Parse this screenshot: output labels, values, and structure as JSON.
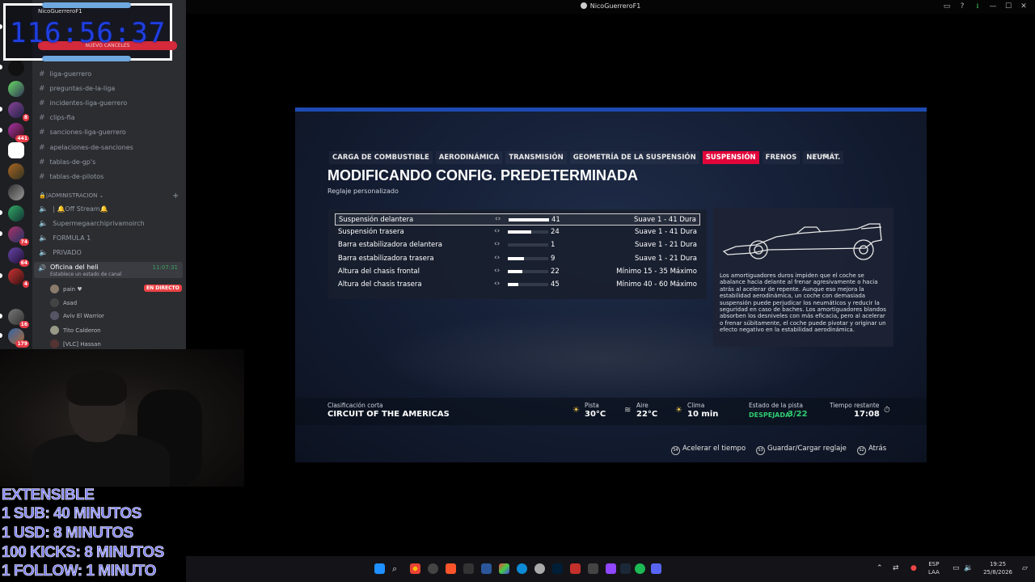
{
  "window": {
    "title": "NicoGuerreroF1"
  },
  "timer": {
    "value": "116:56:37",
    "overlay_name": "NicoGuerreroF1",
    "overlay_bar": "NUEVO CANCELES"
  },
  "discord": {
    "channels": [
      {
        "name": "liga-guerrero"
      },
      {
        "name": "preguntas-de-la-liga"
      },
      {
        "name": "incidentes-liga-guerrero"
      },
      {
        "name": "clips-fia"
      },
      {
        "name": "sanciones-liga-guerrero"
      },
      {
        "name": "apelaciones-de-sanciones"
      },
      {
        "name": "tablas-de-gp's"
      },
      {
        "name": "tablas-de-pilotos"
      }
    ],
    "category": "🔒|ADMINISTRACION",
    "voice_channels": [
      {
        "name": "| 🔔Off Stream🔔"
      },
      {
        "name": "Supermegaarchiprivamoirch"
      },
      {
        "name": "FORMULA 1"
      },
      {
        "name": "PRIVADO"
      }
    ],
    "active_voice": {
      "name": "Oficina del heli",
      "status": "Establece un estado de canal",
      "time": "11:07:31"
    },
    "users": [
      {
        "name": "pain ♥"
      },
      {
        "name": "Asad"
      },
      {
        "name": "Aviv El Warrior"
      },
      {
        "name": "Tito Calderon"
      },
      {
        "name": "[VLC] Hassan"
      }
    ],
    "live_badge": "EN DIRECTO",
    "server_badges": [
      "8",
      "441",
      "74",
      "64",
      "4",
      "16",
      "179"
    ]
  },
  "overlay": {
    "lines": [
      "EXTENSIBLE",
      "1 SUB: 40 MINUTOS",
      "1 USD: 8 MINUTOS",
      "100 KICKS: 8 MINUTOS",
      "1 FOLLOW: 1 MINUTO"
    ],
    "color": "#7b7df5"
  },
  "game": {
    "tabs": [
      {
        "label": "CARGA DE COMBUSTIBLE",
        "active": false
      },
      {
        "label": "AERODINÁMICA",
        "active": false
      },
      {
        "label": "TRANSMISIÓN",
        "active": false
      },
      {
        "label": "GEOMETRÍA DE LA SUSPENSIÓN",
        "active": false
      },
      {
        "label": "SUSPENSIÓN",
        "active": true
      },
      {
        "label": "FRENOS",
        "active": false
      },
      {
        "label": "NEUMÁT.",
        "active": false
      }
    ],
    "title": "MODIFICANDO CONFIG. PREDETERMINADA",
    "subtitle": "Reglaje personalizado",
    "settings": [
      {
        "label": "Suspensión delantera",
        "value": "41",
        "range": "Suave 1 - 41 Dura",
        "fraction": 1.0,
        "selected": true
      },
      {
        "label": "Suspensión trasera",
        "value": "24",
        "range": "Suave 1 - 41 Dura",
        "fraction": 0.575,
        "selected": false
      },
      {
        "label": "Barra estabilizadora delantera",
        "value": "1",
        "range": "Suave 1 - 21 Dura",
        "fraction": 0.0,
        "selected": false
      },
      {
        "label": "Barra estabilizadora trasera",
        "value": "9",
        "range": "Suave 1 - 21 Dura",
        "fraction": 0.4,
        "selected": false
      },
      {
        "label": "Altura del chasis frontal",
        "value": "22",
        "range": "Mínimo 15 - 35 Máximo",
        "fraction": 0.35,
        "selected": false
      },
      {
        "label": "Altura del chasis trasera",
        "value": "45",
        "range": "Mínimo 40 - 60 Máximo",
        "fraction": 0.25,
        "selected": false
      }
    ],
    "description": "Los amortiguadores duros impiden que el coche se abalance hacia delante al frenar agresivamente o hacia atrás al acelerar de repente. Aunque eso mejora la estabilidad aerodinámica, un coche con demasiada suspensión puede perjudicar los neumáticos y reducir la seguridad en caso de baches. Los amortiguadores blandos absorben los desniveles con más eficacia, pero al acelerar o frenar súbitamente, el coche puede pivotar y originar un efecto negativo en la estabilidad aerodinámica.",
    "session": {
      "label": "Clasificación corta",
      "circuit": "CIRCUIT OF THE AMERICAS"
    },
    "conditions": {
      "track_label": "Pista",
      "track_temp": "30°C",
      "air_label": "Aire",
      "air_temp": "22°C",
      "weather_label": "Clima",
      "weather_value": "10 min",
      "state_label": "Estado de la pista",
      "state_value": "DESPEJADA",
      "state_count": "3/22",
      "time_label": "Tiempo restante",
      "time_value": "17:08"
    },
    "footer": [
      {
        "button": "S4",
        "label": "Acelerar el tiempo"
      },
      {
        "button": "S3",
        "label": "Guardar/Cargar reglaje"
      },
      {
        "button": "S2",
        "label": "Atrás"
      }
    ],
    "accent": "#e1063a"
  },
  "taskbar": {
    "lang_top": "ESP",
    "lang_bottom": "LAA",
    "time": "19:25",
    "date": "25/8/2026"
  }
}
